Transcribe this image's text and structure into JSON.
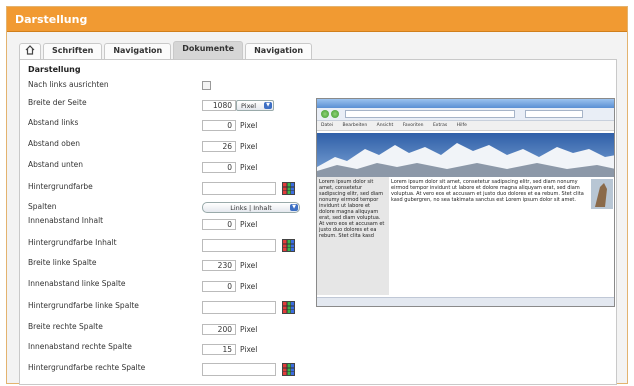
{
  "panel": {
    "title": "Darstellung",
    "title_bg": "#f19a32"
  },
  "tabs": [
    {
      "label": "",
      "icon": "home-icon",
      "active": false
    },
    {
      "label": "Schriften",
      "active": false
    },
    {
      "label": "Navigation",
      "active": false
    },
    {
      "label": "Dokumente",
      "active": true
    },
    {
      "label": "Navigation",
      "active": false
    }
  ],
  "section": {
    "title": "Darstellung"
  },
  "rows": {
    "align_left": {
      "label": "Nach links ausrichten",
      "checked": false
    },
    "page_width": {
      "label": "Breite der Seite",
      "value": "1080",
      "unit_select": "Pixel"
    },
    "margin_left": {
      "label": "Abstand links",
      "value": "0",
      "unit": "Pixel"
    },
    "margin_top": {
      "label": "Abstand oben",
      "value": "26",
      "unit": "Pixel"
    },
    "margin_bottom": {
      "label": "Abstand unten",
      "value": "0",
      "unit": "Pixel"
    },
    "background_color": {
      "label": "Hintergrundfarbe",
      "value": ""
    },
    "columns": {
      "label": "Spalten",
      "select": "Links | Inhalt"
    },
    "content_padding": {
      "label": "Innenabstand Inhalt",
      "value": "0",
      "unit": "Pixel"
    },
    "content_bg": {
      "label": "Hintergrundfarbe Inhalt",
      "value": ""
    },
    "left_col_width": {
      "label": "Breite linke Spalte",
      "value": "230",
      "unit": "Pixel"
    },
    "left_col_padding": {
      "label": "Innenabstand linke Spalte",
      "value": "0",
      "unit": "Pixel"
    },
    "left_col_bg": {
      "label": "Hintergrundfarbe linke Spalte",
      "value": ""
    },
    "right_col_width": {
      "label": "Breite rechte Spalte",
      "value": "200",
      "unit": "Pixel"
    },
    "right_col_padding": {
      "label": "Innenabstand rechte Spalte",
      "value": "15",
      "unit": "Pixel"
    },
    "right_col_bg": {
      "label": "Hintergrundfarbe rechte Spalte",
      "value": ""
    }
  },
  "preview": {
    "menu": [
      "Datei",
      "Bearbeiten",
      "Ansicht",
      "Favoriten",
      "Extras",
      "Hilfe"
    ],
    "left_text": "Lorem ipsum dolor sit amet, consetetur sadipscing elitr, sed diam nonumy eirmod tempor invidunt ut labore et dolore magna aliquyam erat, sed diam voluptua. At vero eos et accusam et justo duo dolores et ea rebum. Stet clita kasd",
    "mid_text": "Lorem ipsum dolor sit amet, consetetur sadipscing elitr, sed diam nonumy eirmod tempor invidunt ut labore et dolore magna aliquyam erat, sed diam voluptua. At vero eos et accusam et justo duo dolores et ea rebum. Stet clita kasd gubergren, no sea takimata sanctus est Lorem ipsum dolor sit amet."
  }
}
